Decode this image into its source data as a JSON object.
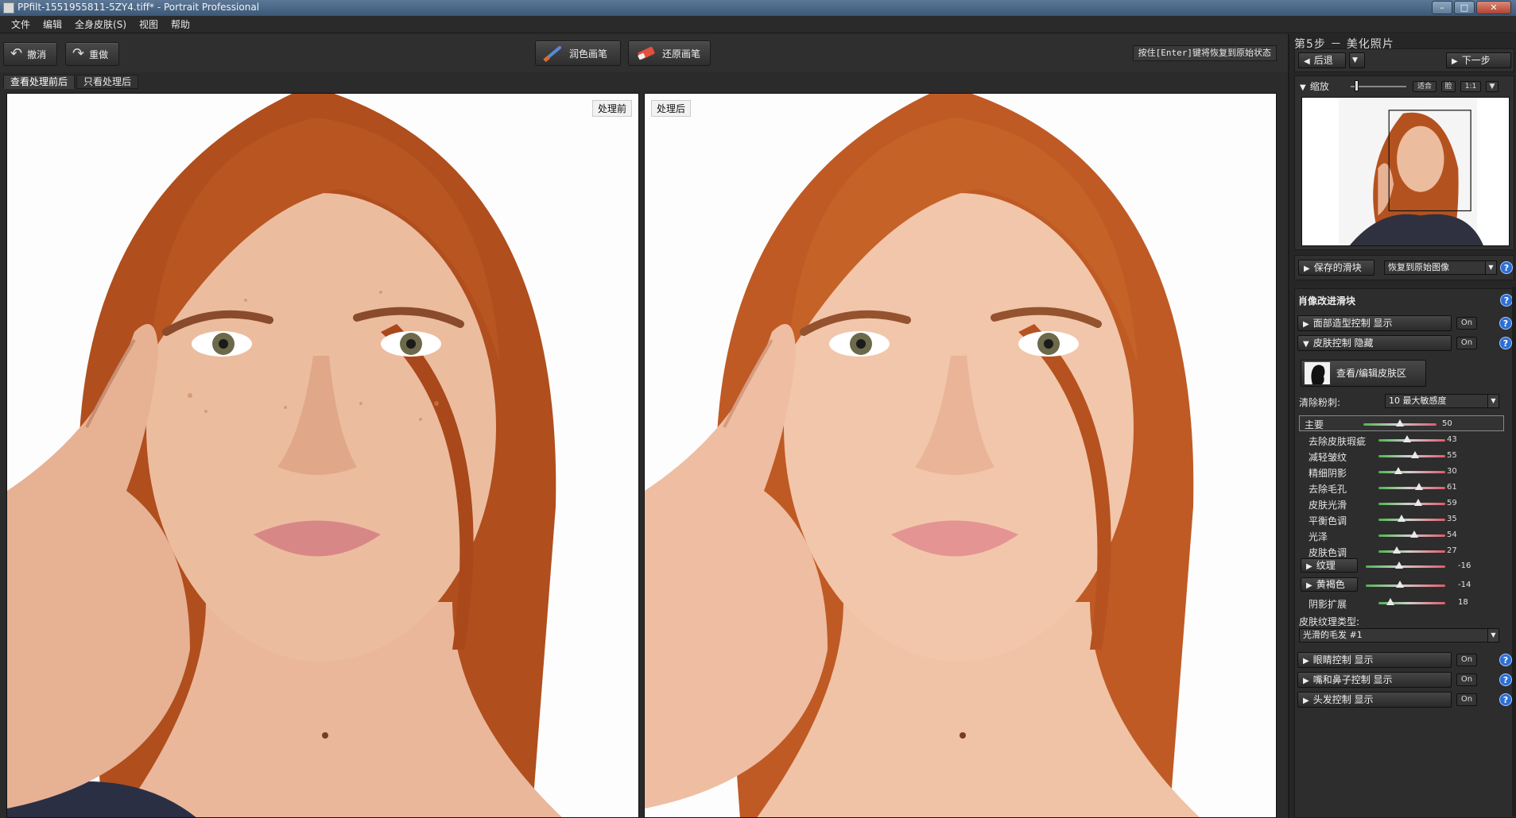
{
  "window": {
    "title": "PPfilt-1551955811-5ZY4.tiff* - Portrait Professional"
  },
  "menu": [
    "文件",
    "编辑",
    "全身皮肤(S)",
    "视图",
    "帮助"
  ],
  "toolbar": {
    "undo_label": "撤消",
    "redo_label": "重做",
    "touchup_brush_label": "润色画笔",
    "restore_brush_label": "还原画笔",
    "hint": "按住[Enter]键将恢复到原始状态"
  },
  "tabs": [
    "查看处理前后",
    "只看处理后"
  ],
  "panes": {
    "before_label": "处理前",
    "after_label": "处理后"
  },
  "right_panel": {
    "step_title": "第5步 － 美化照片",
    "back_label": "后退",
    "next_label": "下一步",
    "zoom_label": "缩放",
    "zoom_buttons": [
      "适合",
      "脸",
      "1:1"
    ],
    "saved_sliders_label": "保存的滑块",
    "restore_dropdown": "恢复到原始图像",
    "portrait_sliders_title": "肖像改进滑块",
    "face_shape": {
      "label": "面部造型控制 显示",
      "badge": "On"
    },
    "skin_control": {
      "label": "皮肤控制 隐藏",
      "badge": "On"
    },
    "view_edit_skin": "查看/编辑皮肤区",
    "remove_powder_label": "清除粉刺:",
    "remove_powder_value": "10 最大敏感度",
    "master": {
      "label": "主要",
      "value": 50
    },
    "sliders": [
      {
        "label": "去除皮肤瑕疵",
        "value": 43
      },
      {
        "label": "减轻皱纹",
        "value": 55
      },
      {
        "label": "精细阴影",
        "value": 30
      },
      {
        "label": "去除毛孔",
        "value": 61
      },
      {
        "label": "皮肤光滑",
        "value": 59
      },
      {
        "label": "平衡色调",
        "value": 35
      },
      {
        "label": "光泽",
        "value": 54
      },
      {
        "label": "皮肤色调",
        "value": 27
      }
    ],
    "texture": {
      "label": "纹理",
      "value": -16
    },
    "yellow_brown": {
      "label": "黄褐色",
      "value": -14
    },
    "shadow_expand": {
      "label": "阴影扩展",
      "value": 18
    },
    "skin_texture_type_label": "皮肤纹理类型:",
    "skin_texture_type_value": "光滑的毛发 #1",
    "eye_control": {
      "label": "眼睛控制 显示",
      "badge": "On"
    },
    "mouth_nose": {
      "label": "嘴和鼻子控制 显示",
      "badge": "On"
    },
    "hair_control": {
      "label": "头发控制 显示",
      "badge": "On"
    }
  },
  "colors": {
    "accent_blue": "#2d6fd3",
    "hair": "#b4521f",
    "skin": "#e8b99c"
  }
}
